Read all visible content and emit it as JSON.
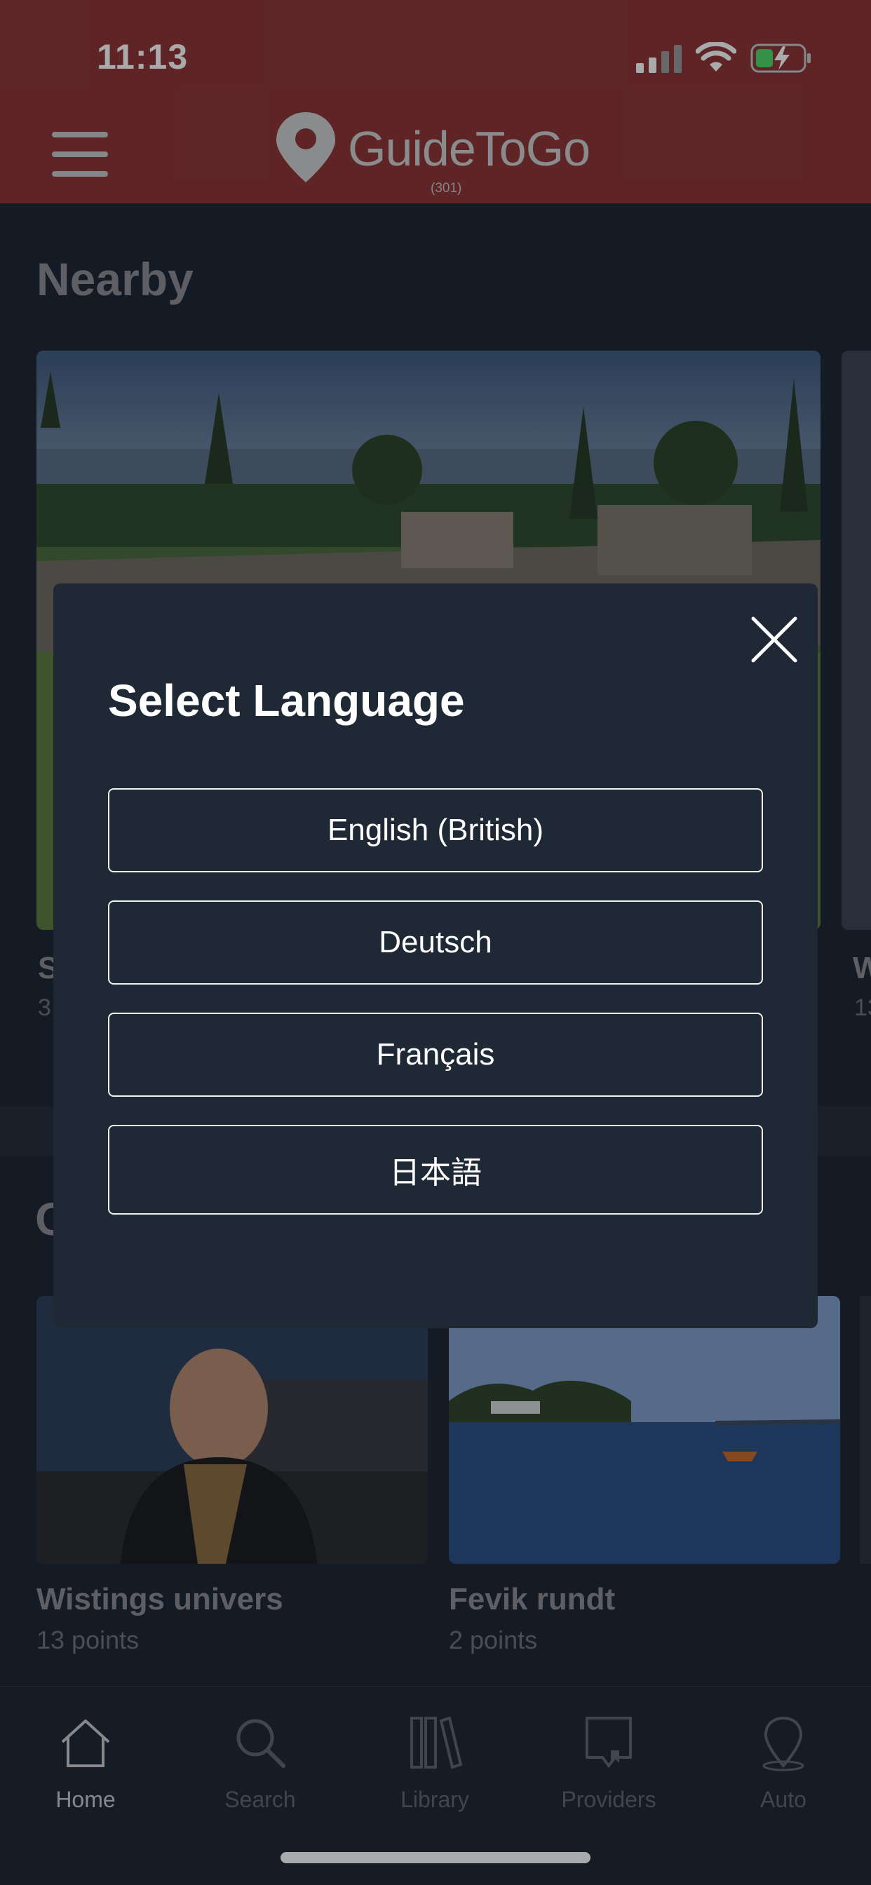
{
  "status_bar": {
    "time": "11:13"
  },
  "header": {
    "brand": "GuideToGo",
    "version": "(301)"
  },
  "nearby": {
    "title": "Nearby",
    "card_title_partial": "S",
    "card_sub_partial": "3",
    "next_title_partial": "W",
    "next_sub_partial": "13"
  },
  "section2": {
    "title_partial": "C"
  },
  "tours": [
    {
      "title": "Wistings univers",
      "points": "13 points"
    },
    {
      "title": "Fevik rundt",
      "points": "2 points"
    }
  ],
  "tabs": [
    {
      "label": "Home",
      "icon": "home-icon"
    },
    {
      "label": "Search",
      "icon": "search-icon"
    },
    {
      "label": "Library",
      "icon": "library-icon"
    },
    {
      "label": "Providers",
      "icon": "providers-icon"
    },
    {
      "label": "Auto",
      "icon": "auto-icon"
    }
  ],
  "modal": {
    "title": "Select Language",
    "languages": [
      "English (British)",
      "Deutsch",
      "Français",
      "日本語"
    ]
  },
  "colors": {
    "header": "#8e3432",
    "background": "#1c2430",
    "modal": "#1f2936"
  }
}
